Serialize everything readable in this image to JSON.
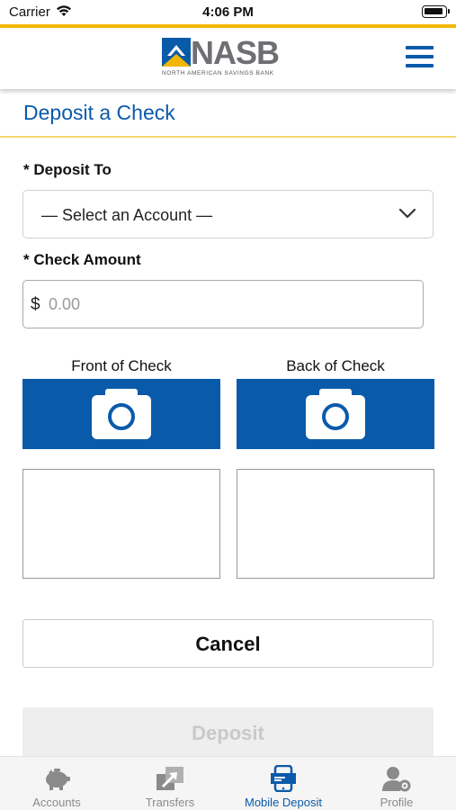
{
  "status_bar": {
    "carrier": "Carrier",
    "time": "4:06 PM"
  },
  "header": {
    "logo_text": "NASB",
    "logo_subtitle": "NORTH AMERICAN SAVINGS BANK",
    "menu_icon": "hamburger-menu-icon",
    "brand_blue": "#0a5aaa",
    "brand_gold": "#f2b705"
  },
  "page": {
    "title": "Deposit a Check"
  },
  "form": {
    "deposit_to_label": "* Deposit To",
    "deposit_to_selected": "— Select an Account —",
    "check_amount_label": "* Check Amount",
    "currency_symbol": "$",
    "amount_placeholder": "0.00",
    "amount_value": ""
  },
  "check_images": {
    "front_label": "Front of Check",
    "back_label": "Back of Check",
    "capture_icon": "camera-icon"
  },
  "actions": {
    "cancel_label": "Cancel",
    "deposit_label": "Deposit"
  },
  "tab_bar": {
    "tabs": [
      {
        "label": "Accounts",
        "icon": "piggy-bank-icon",
        "active": false
      },
      {
        "label": "Transfers",
        "icon": "transfer-arrows-icon",
        "active": false
      },
      {
        "label": "Mobile Deposit",
        "icon": "mobile-deposit-icon",
        "active": true
      },
      {
        "label": "Profile",
        "icon": "user-gear-icon",
        "active": false
      }
    ]
  }
}
